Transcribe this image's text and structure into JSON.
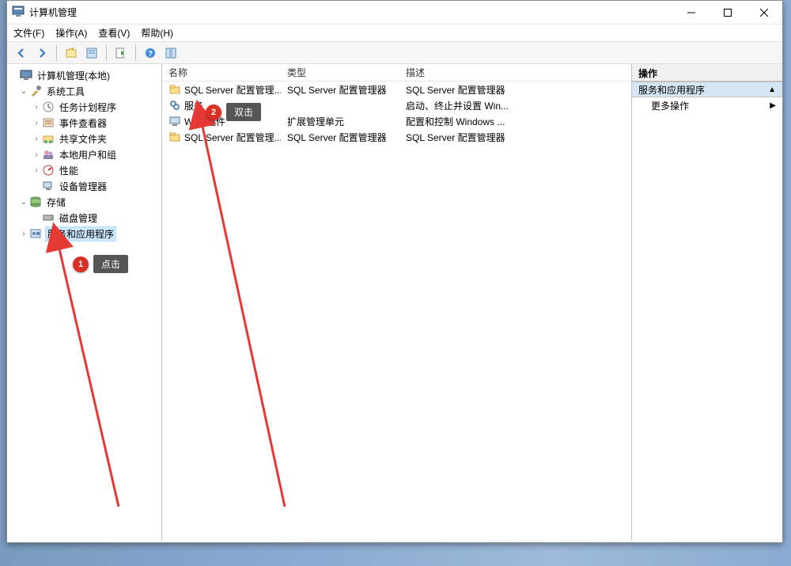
{
  "window": {
    "title": "计算机管理"
  },
  "menu": [
    "文件(F)",
    "操作(A)",
    "查看(V)",
    "帮助(H)"
  ],
  "tree": {
    "root": "计算机管理(本地)",
    "systools": "系统工具",
    "items_sys": [
      "任务计划程序",
      "事件查看器",
      "共享文件夹",
      "本地用户和组",
      "性能",
      "设备管理器"
    ],
    "storage": "存储",
    "disk": "磁盘管理",
    "services_apps": "服务和应用程序"
  },
  "list": {
    "hdr": {
      "name": "名称",
      "type": "类型",
      "desc": "描述"
    },
    "rows": [
      {
        "name": "SQL Server 配置管理...",
        "type": "SQL Server 配置管理器",
        "desc": "SQL Server 配置管理器"
      },
      {
        "name": "服务",
        "type": "",
        "desc": "启动、终止并设置 Win..."
      },
      {
        "name": "WMI 控件",
        "type": "扩展管理单元",
        "desc": "配置和控制 Windows ..."
      },
      {
        "name": "SQL Server 配置管理...",
        "type": "SQL Server 配置管理器",
        "desc": "SQL Server 配置管理器"
      }
    ]
  },
  "right": {
    "hdr": "操作",
    "cat": "服务和应用程序",
    "more": "更多操作"
  },
  "callouts": {
    "c1": {
      "num": "1",
      "txt": "点击"
    },
    "c2": {
      "num": "2",
      "txt": "双击"
    }
  }
}
